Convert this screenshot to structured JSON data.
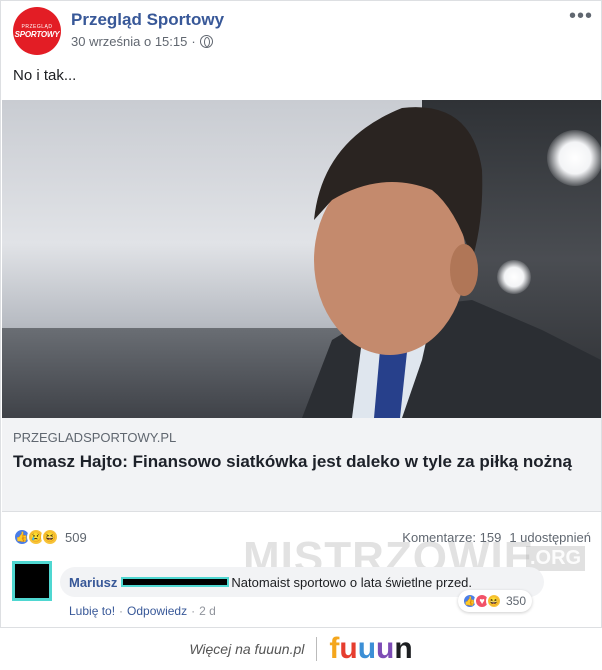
{
  "post": {
    "page_name": "Przegląd Sportowy",
    "avatar_text_small": "PRZEGLĄD",
    "avatar_text_big": "SPORTOWY",
    "timestamp": "30 września o 15:15",
    "separator": "·",
    "more_label": "•••",
    "text": "No i tak..."
  },
  "link_preview": {
    "domain": "PRZEGLADSPORTOWY.PL",
    "headline": "Tomasz Hajto: Finansowo siatkówka jest daleko w tyle za piłką nożną"
  },
  "reactions": {
    "count": "509",
    "comments": "Komentarze: 159",
    "shares": "1 udostępnień",
    "icons": [
      "like-icon",
      "sad-icon",
      "haha-icon"
    ]
  },
  "comment": {
    "author": "Mariusz",
    "text": "Natomaist sportowo o lata świetlne przed.",
    "like": "Lubię to!",
    "reply": "Odpowiedz",
    "dot": "·",
    "age": "2 d",
    "reaction_count": "350",
    "icons": [
      "like-icon",
      "love-icon",
      "haha-icon"
    ]
  },
  "watermark": {
    "text": "MISTRZOWIE",
    "org": ".ORG"
  },
  "footer": {
    "text": "Więcej na fuuun.pl",
    "logo": [
      "f",
      "u",
      "u",
      "u",
      "n"
    ]
  }
}
